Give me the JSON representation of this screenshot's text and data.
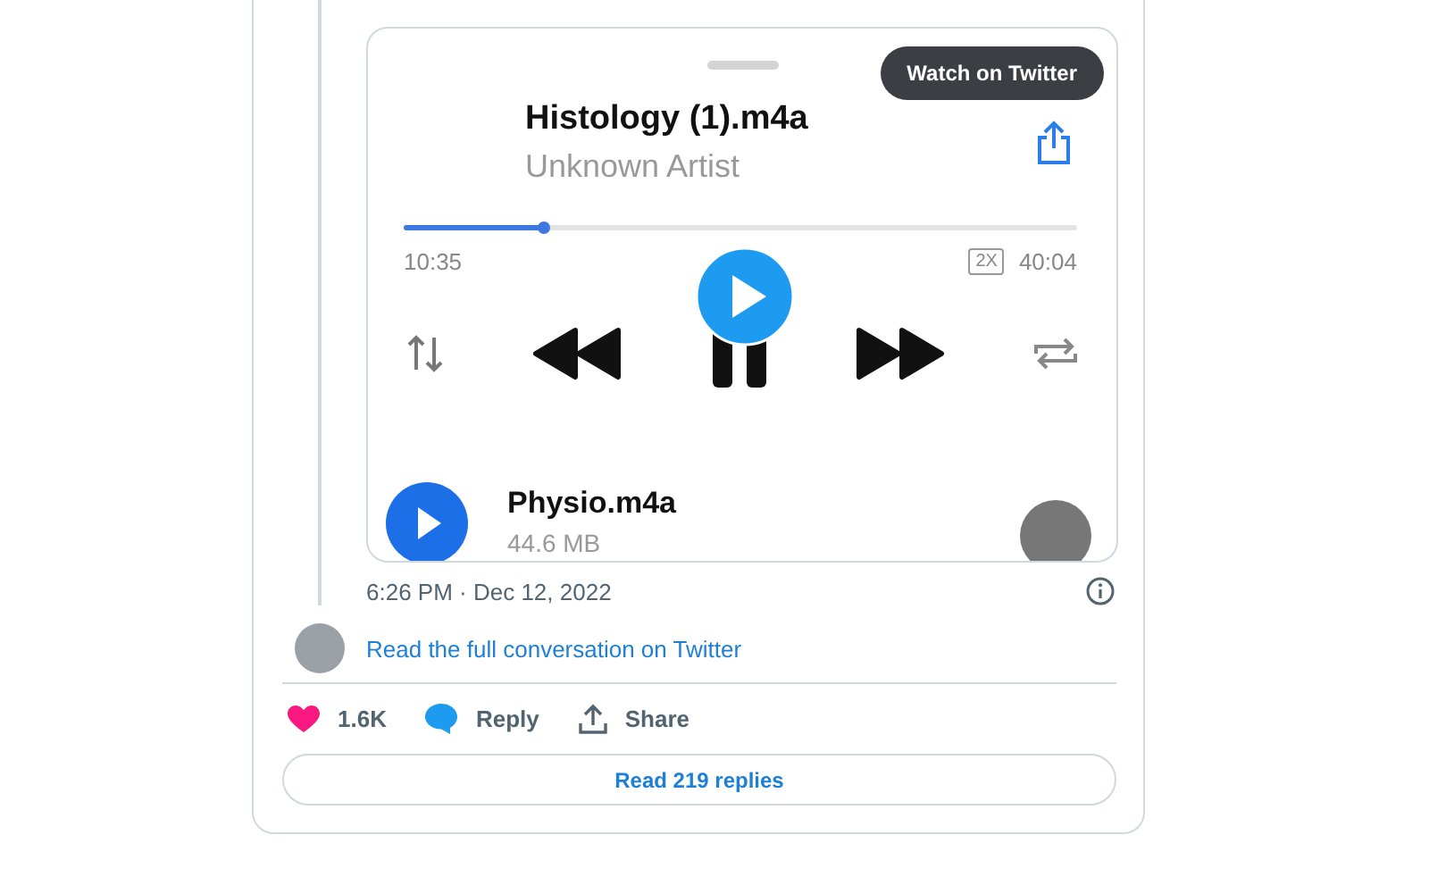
{
  "video": {
    "overlay_button": "Watch on Twitter",
    "player": {
      "title": "Histology (1).m4a",
      "artist": "Unknown Artist",
      "level": 0.21,
      "elapsed": "10:35",
      "speed": "2X",
      "duration": "40:04"
    },
    "next_track": {
      "title": "Physio.m4a",
      "size": "44.6 MB"
    }
  },
  "timestamp": "6:26 PM · Dec 12, 2022",
  "conversation_link": "Read the full conversation on Twitter",
  "actions": [
    {
      "kind": "like",
      "label": "1.6K"
    },
    {
      "kind": "reply",
      "label": "Reply"
    },
    {
      "kind": "share",
      "label": "Share"
    }
  ],
  "replies_button": "Read 219 replies"
}
